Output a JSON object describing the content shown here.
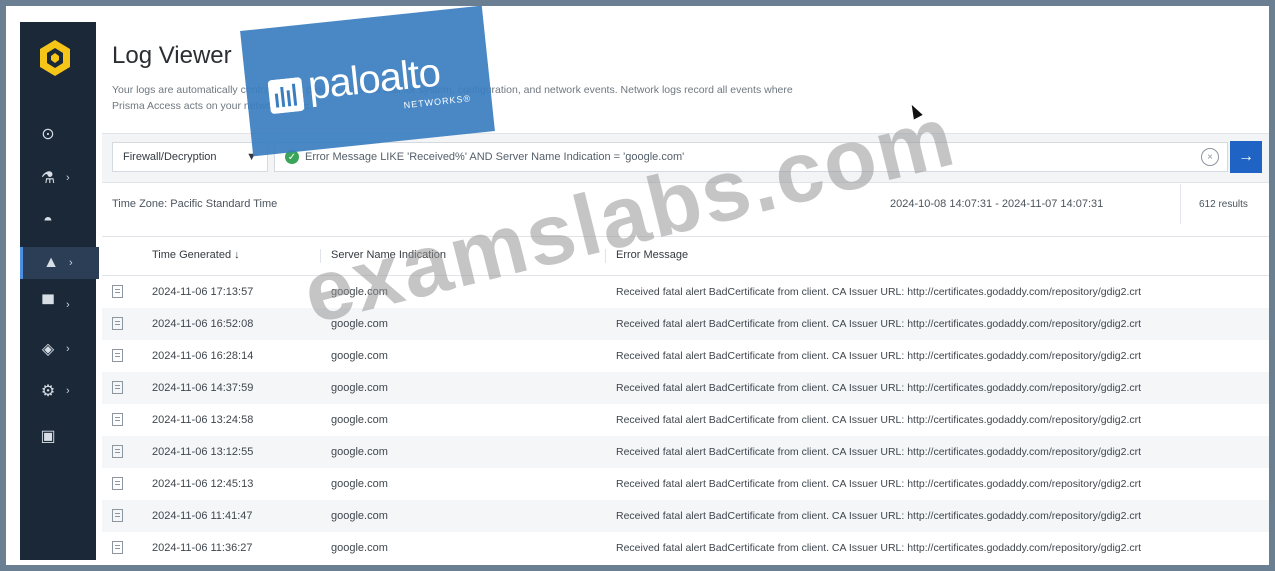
{
  "header": {
    "title": "Log Viewer",
    "description": "Your logs are automatically centralized to provide an audit trail for system, configuration, and network events. Network logs record all events where Prisma Access acts on your network traffic."
  },
  "sidebar": {
    "items": [
      {
        "icon": "radar-icon",
        "glyph": "⊙",
        "chevron": ""
      },
      {
        "icon": "activity-icon",
        "glyph": "⚗",
        "chevron": "›"
      },
      {
        "icon": "dashboard-icon",
        "glyph": "◓",
        "chevron": ""
      },
      {
        "icon": "monitor-icon",
        "glyph": "▲",
        "chevron": "›",
        "active": true
      },
      {
        "icon": "devices-icon",
        "glyph": "▀",
        "chevron": "›"
      },
      {
        "icon": "shield-icon",
        "glyph": "◈",
        "chevron": "›"
      },
      {
        "icon": "gear-icon",
        "glyph": "⚙",
        "chevron": "›"
      },
      {
        "icon": "report-icon",
        "glyph": "▣",
        "chevron": ""
      }
    ]
  },
  "filter": {
    "log_type": "Firewall/Decryption",
    "query": "Error Message LIKE 'Received%' AND Server Name Indication = 'google.com'"
  },
  "meta": {
    "timezone": "Time Zone: Pacific Standard Time",
    "range": "2024-10-08 14:07:31 - 2024-11-07 14:07:31",
    "results": "612 results"
  },
  "table": {
    "columns": [
      "Time Generated",
      "Server Name Indication",
      "Error Message"
    ],
    "rows": [
      {
        "time": "2024-11-06 17:13:57",
        "sni": "google.com",
        "error": "Received fatal alert BadCertificate from client. CA Issuer URL: http://certificates.godaddy.com/repository/gdig2.crt"
      },
      {
        "time": "2024-11-06 16:52:08",
        "sni": "google.com",
        "error": "Received fatal alert BadCertificate from client. CA Issuer URL: http://certificates.godaddy.com/repository/gdig2.crt"
      },
      {
        "time": "2024-11-06 16:28:14",
        "sni": "google.com",
        "error": "Received fatal alert BadCertificate from client. CA Issuer URL: http://certificates.godaddy.com/repository/gdig2.crt"
      },
      {
        "time": "2024-11-06 14:37:59",
        "sni": "google.com",
        "error": "Received fatal alert BadCertificate from client. CA Issuer URL: http://certificates.godaddy.com/repository/gdig2.crt"
      },
      {
        "time": "2024-11-06 13:24:58",
        "sni": "google.com",
        "error": "Received fatal alert BadCertificate from client. CA Issuer URL: http://certificates.godaddy.com/repository/gdig2.crt"
      },
      {
        "time": "2024-11-06 13:12:55",
        "sni": "google.com",
        "error": "Received fatal alert BadCertificate from client. CA Issuer URL: http://certificates.godaddy.com/repository/gdig2.crt"
      },
      {
        "time": "2024-11-06 12:45:13",
        "sni": "google.com",
        "error": "Received fatal alert BadCertificate from client. CA Issuer URL: http://certificates.godaddy.com/repository/gdig2.crt"
      },
      {
        "time": "2024-11-06 11:41:47",
        "sni": "google.com",
        "error": "Received fatal alert BadCertificate from client. CA Issuer URL: http://certificates.godaddy.com/repository/gdig2.crt"
      },
      {
        "time": "2024-11-06 11:36:27",
        "sni": "google.com",
        "error": "Received fatal alert BadCertificate from client. CA Issuer URL: http://certificates.godaddy.com/repository/gdig2.crt"
      }
    ]
  },
  "overlay": {
    "brand_name": "paloalto",
    "brand_sub": "NETWORKS®",
    "watermark": "examslabs.com"
  },
  "colors": {
    "sidebar_bg": "#1b2838",
    "accent": "#1f63c4",
    "logo_yellow": "#f5c518",
    "status_ok": "#3aa45a"
  }
}
